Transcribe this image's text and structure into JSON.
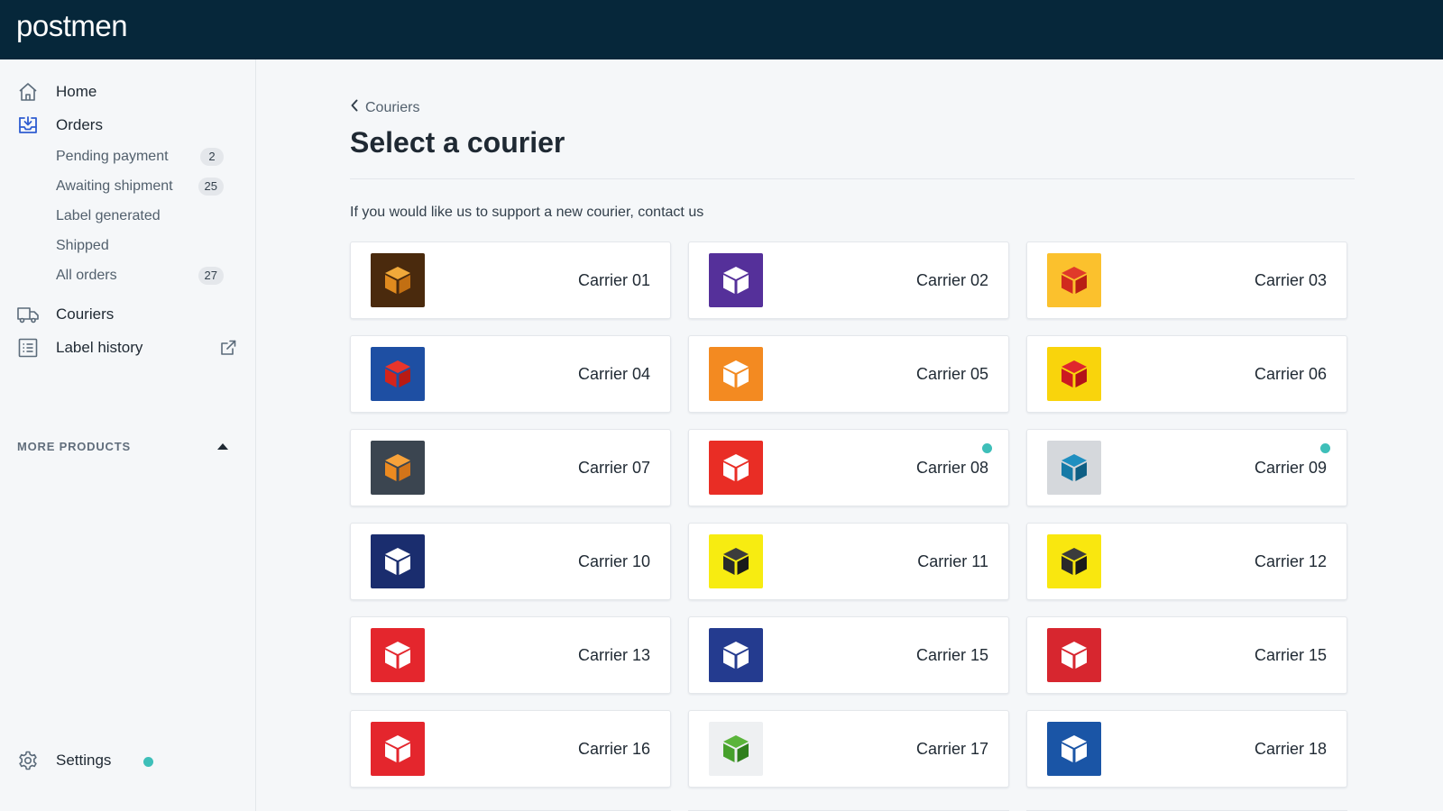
{
  "app": {
    "logo": "postmen"
  },
  "sidebar": {
    "home": {
      "label": "Home",
      "icon": "home-icon"
    },
    "orders": {
      "label": "Orders",
      "icon": "inbox-download-icon",
      "items": [
        {
          "label": "Pending payment",
          "count": "2"
        },
        {
          "label": "Awaiting shipment",
          "count": "25"
        },
        {
          "label": "Label generated",
          "count": null
        },
        {
          "label": "Shipped",
          "count": null
        },
        {
          "label": "All orders",
          "count": "27"
        }
      ]
    },
    "couriers": {
      "label": "Couriers",
      "icon": "truck-icon"
    },
    "label_history": {
      "label": "Label history",
      "icon": "list-icon",
      "external_icon": "external-link-icon"
    },
    "more_products": {
      "label": "MORE PRODUCTS",
      "icon": "caret-up-icon"
    },
    "settings": {
      "label": "Settings",
      "icon": "gear-icon",
      "status_color": "#3ebfb9"
    }
  },
  "main": {
    "breadcrumb": "Couriers",
    "title": "Select a courier",
    "hint": "If you would like us to support a new courier, contact us",
    "carriers": [
      {
        "name": "Carrier 01",
        "bg": "#4a2a0d",
        "top": "#f0a93a",
        "left": "#e08a1e",
        "right": "#c26f12",
        "dot": false
      },
      {
        "name": "Carrier 02",
        "bg": "#55309a",
        "top": "#ffffff",
        "left": "#ffffff",
        "right": "#ffffff",
        "dot": false
      },
      {
        "name": "Carrier 03",
        "bg": "#fbc12d",
        "top": "#e03a2a",
        "left": "#d12a1e",
        "right": "#b81e14",
        "dot": false
      },
      {
        "name": "Carrier 04",
        "bg": "#1e4fa3",
        "top": "#e8352b",
        "left": "#d4241b",
        "right": "#b81a13",
        "dot": false
      },
      {
        "name": "Carrier 05",
        "bg": "#f38a21",
        "top": "#ffffff",
        "left": "#ffffff",
        "right": "#ffffff",
        "dot": false
      },
      {
        "name": "Carrier 06",
        "bg": "#f9d40c",
        "top": "#e0262d",
        "left": "#cc1a21",
        "right": "#b31219",
        "dot": false
      },
      {
        "name": "Carrier 07",
        "bg": "#3b4550",
        "top": "#f7a23a",
        "left": "#ec8a20",
        "right": "#d2741a",
        "dot": false
      },
      {
        "name": "Carrier 08",
        "bg": "#e92d25",
        "top": "#ffffff",
        "left": "#ffffff",
        "right": "#ffffff",
        "dot": true
      },
      {
        "name": "Carrier 09",
        "bg": "#d5d8dc",
        "top": "#1f8fc0",
        "left": "#167aa6",
        "right": "#0f5f84",
        "dot": true
      },
      {
        "name": "Carrier 10",
        "bg": "#1a2d6e",
        "top": "#ffffff",
        "left": "#ffffff",
        "right": "#ffffff",
        "dot": false
      },
      {
        "name": "Carrier 11",
        "bg": "#f7ec11",
        "top": "#3c3c3c",
        "left": "#2a2a2a",
        "right": "#1a1a1a",
        "dot": false
      },
      {
        "name": "Carrier 12",
        "bg": "#f9e70f",
        "top": "#3c3c3c",
        "left": "#2a2a2a",
        "right": "#1a1a1a",
        "dot": false
      },
      {
        "name": "Carrier 13",
        "bg": "#e4262d",
        "top": "#ffffff",
        "left": "#ffffff",
        "right": "#ffffff",
        "dot": false
      },
      {
        "name": "Carrier 15",
        "bg": "#243b8f",
        "top": "#ffffff",
        "left": "#ffffff",
        "right": "#ffffff",
        "dot": false
      },
      {
        "name": "Carrier 15",
        "bg": "#d7262f",
        "top": "#ffffff",
        "left": "#ffffff",
        "right": "#ffffff",
        "dot": false
      },
      {
        "name": "Carrier 16",
        "bg": "#e4262d",
        "top": "#ffffff",
        "left": "#ffffff",
        "right": "#ffffff",
        "dot": false
      },
      {
        "name": "Carrier 17",
        "bg": "#eef0f2",
        "top": "#5ab43a",
        "left": "#46a02c",
        "right": "#2f7f1d",
        "dot": false
      },
      {
        "name": "Carrier 18",
        "bg": "#1a55a6",
        "top": "#ffffff",
        "left": "#ffffff",
        "right": "#ffffff",
        "dot": false
      }
    ]
  },
  "colors": {
    "topbar": "#06273a",
    "accent_dot": "#3ebfb9",
    "page_bg": "#f5f7f9"
  }
}
